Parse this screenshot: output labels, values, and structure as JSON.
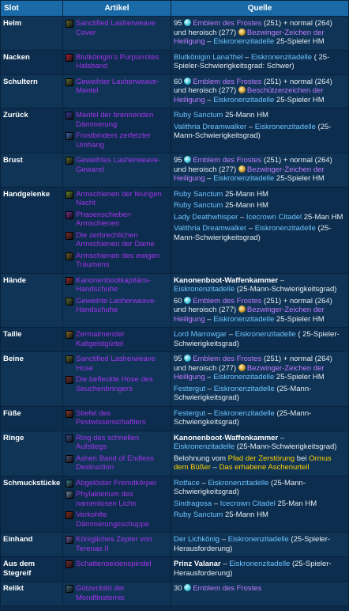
{
  "header": {
    "slot": "Slot",
    "artikel": "Artikel",
    "quelle": "Quelle"
  },
  "rows": [
    {
      "slot": "Helm",
      "items": [
        {
          "name": "Sanctified Lasherweave Cover",
          "color": "#5c6a2a"
        }
      ],
      "sources": [
        {
          "parts": [
            {
              "t": "95 "
            },
            {
              "icon": "frost-emblem"
            },
            {
              "t": "Emblem des Frostes",
              "c": "pu"
            },
            {
              "t": " (251) + normal (264) und heroisch (277) "
            },
            {
              "icon": "triumph-emblem"
            },
            {
              "t": "Bezwinger-Zeichen der Heiligung",
              "c": "pu"
            },
            {
              "t": " – "
            },
            {
              "t": "Eiskronenzitadelle",
              "c": "lk"
            },
            {
              "t": " 25-Spieler HM"
            }
          ]
        }
      ]
    },
    {
      "slot": "Nacken",
      "items": [
        {
          "name": "Blutkönigin's Purpurrotes Halsband",
          "color": "#b0203a"
        }
      ],
      "sources": [
        {
          "parts": [
            {
              "t": "Blutkönigin Lana'thel",
              "c": "lk"
            },
            {
              "t": " – "
            },
            {
              "t": "Eiskronenzitadelle",
              "c": "lk"
            },
            {
              "t": " ( 25-Spieler-Schwierigkeitsgrad: Schwer)"
            }
          ]
        }
      ]
    },
    {
      "slot": "Schultern",
      "items": [
        {
          "name": "Geweihter Lasherweave-Mantel",
          "color": "#5c6a2a"
        }
      ],
      "sources": [
        {
          "parts": [
            {
              "t": "60 "
            },
            {
              "icon": "frost-emblem"
            },
            {
              "t": "Emblem des Frostes",
              "c": "pu"
            },
            {
              "t": " (251) + normal (264) und heroisch (277) "
            },
            {
              "icon": "triumph-emblem"
            },
            {
              "t": "Beschützerzeichen der Heiligung",
              "c": "pu"
            },
            {
              "t": " – "
            },
            {
              "t": "Eiskronenzitadelle",
              "c": "lk"
            },
            {
              "t": " 25-Spieler HM"
            }
          ]
        }
      ]
    },
    {
      "slot": "Zurück",
      "items": [
        {
          "name": "Mantel der brennenden Dämmerung",
          "color": "#3a3aa0"
        },
        {
          "name": "Frostbinders zerfetzter Umhang",
          "color": "#3a6ab0"
        }
      ],
      "sources": [
        {
          "parts": [
            {
              "t": "Ruby Sanctum",
              "c": "lk"
            },
            {
              "t": " 25-Mann HM"
            }
          ]
        },
        {
          "parts": [
            {
              "t": "Valithria Dreamwalker",
              "c": "lk"
            },
            {
              "t": " – "
            },
            {
              "t": "Eiskronenzitadelle",
              "c": "lk"
            },
            {
              "t": " (25-Mann-Schwierigkeitsgrad)"
            }
          ]
        }
      ]
    },
    {
      "slot": "Brust",
      "items": [
        {
          "name": "Geweihtes Lasherweave-Gewand",
          "color": "#5c6a2a"
        }
      ],
      "sources": [
        {
          "parts": [
            {
              "t": "95 "
            },
            {
              "icon": "frost-emblem"
            },
            {
              "t": "Emblem des Frostes",
              "c": "pu"
            },
            {
              "t": " (251) + normal (264) und heroisch (277) "
            },
            {
              "icon": "triumph-emblem"
            },
            {
              "t": "Bezwinger-Zeichen der Heiligung",
              "c": "pu"
            },
            {
              "t": " – "
            },
            {
              "t": "Eiskronenzitadelle",
              "c": "lk"
            },
            {
              "t": " 25-Spieler HM"
            }
          ]
        }
      ]
    },
    {
      "slot": "Handgelenke",
      "items": [
        {
          "name": "Armschienen der feurigen Nacht",
          "color": "#6a8a2a"
        },
        {
          "name": "Phasenschieber-Armschienen",
          "color": "#7a2a8a"
        },
        {
          "name": "Die zerbrechlichen Armschienen der Dame",
          "color": "#8a2a2a"
        },
        {
          "name": "Armschienen des ewigen Träumens",
          "color": "#6a5a2a"
        }
      ],
      "sources": [
        {
          "parts": [
            {
              "t": "Ruby Sanctum",
              "c": "lk"
            },
            {
              "t": " 25-Mann HM"
            }
          ]
        },
        {
          "parts": [
            {
              "t": "Ruby Sanctum",
              "c": "lk"
            },
            {
              "t": " 25-Mann HM"
            }
          ]
        },
        {
          "parts": [
            {
              "t": "Lady Deathwhisper",
              "c": "lk"
            },
            {
              "t": " – "
            },
            {
              "t": "Icecrown Citadel",
              "c": "lk"
            },
            {
              "t": " 25-Man HM"
            }
          ]
        },
        {
          "parts": [
            {
              "t": "Valithria Dreamwalker",
              "c": "lk"
            },
            {
              "t": " – "
            },
            {
              "t": "Eiskronenzitadelle",
              "c": "lk"
            },
            {
              "t": " (25-Mann-Schwierigkeitsgrad)"
            }
          ]
        }
      ]
    },
    {
      "slot": "Hände",
      "items": [
        {
          "name": "Kanonenbootkapitäns-Handschuhe",
          "color": "#9a2a2a"
        },
        {
          "name": "Geweihte Lasherweave-Handschuhe",
          "color": "#5c6a2a"
        }
      ],
      "sources": [
        {
          "parts": [
            {
              "t": "Kanonenboot-Waffenkammer",
              "c": "b"
            },
            {
              "t": " – "
            },
            {
              "t": "Eiskronenzitadelle",
              "c": "lk"
            },
            {
              "t": " (25-Mann-Schwierigkeitsgrad)"
            }
          ]
        },
        {
          "parts": [
            {
              "t": "60 "
            },
            {
              "icon": "frost-emblem"
            },
            {
              "t": "Emblem des Frostes",
              "c": "pu"
            },
            {
              "t": " (251) + normal (264) und heroisch (277) "
            },
            {
              "icon": "triumph-emblem"
            },
            {
              "t": "Bezwinger-Zeichen der Heiligung",
              "c": "pu"
            },
            {
              "t": " – "
            },
            {
              "t": "Eiskronenzitadelle",
              "c": "lk"
            },
            {
              "t": " 25-Spieler HM"
            }
          ]
        }
      ]
    },
    {
      "slot": "Taille",
      "items": [
        {
          "name": "Zermalmender Kaltgeistgürtel",
          "color": "#8a6a2a"
        }
      ],
      "sources": [
        {
          "parts": [
            {
              "t": "Lord Marrowgar",
              "c": "lk"
            },
            {
              "t": " – "
            },
            {
              "t": "Eiskronenzitadelle",
              "c": "lk"
            },
            {
              "t": " ( 25-Spieler-Schwierigkeitsgrad)"
            }
          ]
        }
      ]
    },
    {
      "slot": "Beine",
      "items": [
        {
          "name": "Sanctified Lasherweave Hose",
          "color": "#5c6a2a"
        },
        {
          "name": "Die befleckte Hose des Seuchenbringers",
          "color": "#7a2a2a"
        }
      ],
      "sources": [
        {
          "parts": [
            {
              "t": "95 "
            },
            {
              "icon": "frost-emblem"
            },
            {
              "t": "Emblem des Frostes",
              "c": "pu"
            },
            {
              "t": " (251) + normal (264) und heroisch (277) "
            },
            {
              "icon": "triumph-emblem"
            },
            {
              "t": "Bezwinger-Zeichen der Heiligung",
              "c": "pu"
            },
            {
              "t": " – "
            },
            {
              "t": "Eiskronenzitadelle",
              "c": "lk"
            },
            {
              "t": " 25-Spieler HM"
            }
          ]
        },
        {
          "parts": [
            {
              "t": "Festergut",
              "c": "lk"
            },
            {
              "t": " – "
            },
            {
              "t": "Eiskronenzitadelle",
              "c": "lk"
            },
            {
              "t": " (25-Mann-Schwierigkeitsgrad)"
            }
          ]
        }
      ]
    },
    {
      "slot": "Füße",
      "items": [
        {
          "name": "Stiefel des Pestwissenschaftlers",
          "color": "#8a3a2a"
        }
      ],
      "sources": [
        {
          "parts": [
            {
              "t": "Festergut",
              "c": "lk"
            },
            {
              "t": " – "
            },
            {
              "t": "Eiskronenzitadelle",
              "c": "lk"
            },
            {
              "t": " (25-Mann-Schwierigkeitsgrad)"
            }
          ]
        }
      ]
    },
    {
      "slot": "Ringe",
      "items": [
        {
          "name": "Ring des schnellen Aufstiegs",
          "color": "#3a4a8a"
        },
        {
          "name": "Ashen Band of Endless Destruction",
          "color": "#4a4a6a"
        }
      ],
      "sources": [
        {
          "parts": [
            {
              "t": "Kanonenboot-Waffenkammer",
              "c": "b"
            },
            {
              "t": " – "
            },
            {
              "t": "Eiskronenzitadelle",
              "c": "lk"
            },
            {
              "t": " (25-Mann-Schwierigkeitsgrad)"
            }
          ]
        },
        {
          "parts": [
            {
              "t": "Belohnung vom "
            },
            {
              "t": "Pfad der Zerstörung",
              "c": "yl"
            },
            {
              "t": " bei "
            },
            {
              "t": "Ormus dem Büßer",
              "c": "yl"
            },
            {
              "t": " – "
            },
            {
              "t": "Das erhabene Aschenurteil",
              "c": "yl"
            }
          ]
        }
      ]
    },
    {
      "slot": "Schmuckstücke",
      "items": [
        {
          "name": "Abgelöster Fremdkörper",
          "color": "#3a7a8a"
        },
        {
          "name": "Phylakterium des namenlosen Lichs",
          "color": "#6a8aa0"
        },
        {
          "name": "Verkohlte Dämmerungsschuppe",
          "color": "#8a2a1a"
        }
      ],
      "sources": [
        {
          "parts": [
            {
              "t": "Rotface",
              "c": "lk"
            },
            {
              "t": " – "
            },
            {
              "t": "Eiskronenzitadelle",
              "c": "lk"
            },
            {
              "t": " (25-Mann-Schwierigkeitsgrad)"
            }
          ]
        },
        {
          "parts": [
            {
              "t": "Sindragosa",
              "c": "lk"
            },
            {
              "t": " – "
            },
            {
              "t": "Icecrown Citadel",
              "c": "lk"
            },
            {
              "t": " 25-Man HM"
            }
          ]
        },
        {
          "parts": [
            {
              "t": "Ruby Sanctum",
              "c": "lk"
            },
            {
              "t": " 25-Mann HM"
            }
          ]
        }
      ]
    },
    {
      "slot": "Einhand",
      "items": [
        {
          "name": "Königliches Zepter von Terenas II",
          "color": "#6a5aa0"
        }
      ],
      "sources": [
        {
          "parts": [
            {
              "t": "Der Lichkönig",
              "c": "lk"
            },
            {
              "t": " – "
            },
            {
              "t": "Eiskronenzitadelle",
              "c": "lk"
            },
            {
              "t": " (25-Spieler-Herausforderung)"
            }
          ]
        }
      ]
    },
    {
      "slot": "Aus dem Stegreif",
      "items": [
        {
          "name": "Schattenseidenspindel",
          "color": "#7a2a2a"
        }
      ],
      "sources": [
        {
          "parts": [
            {
              "t": "Prinz Valanar",
              "c": "b"
            },
            {
              "t": " – "
            },
            {
              "t": "Eiskronenzitadelle",
              "c": "lk"
            },
            {
              "t": " (25-Spieler-Herausforderung)"
            }
          ]
        }
      ]
    },
    {
      "slot": "Relikt",
      "items": [
        {
          "name": "Götzenbild der Mondfinsternis",
          "color": "#3a6a7a"
        }
      ],
      "sources": [
        {
          "parts": [
            {
              "t": "30 "
            },
            {
              "icon": "frost-emblem"
            },
            {
              "t": "Emblem des Frostes",
              "c": "pu"
            }
          ]
        }
      ]
    }
  ]
}
